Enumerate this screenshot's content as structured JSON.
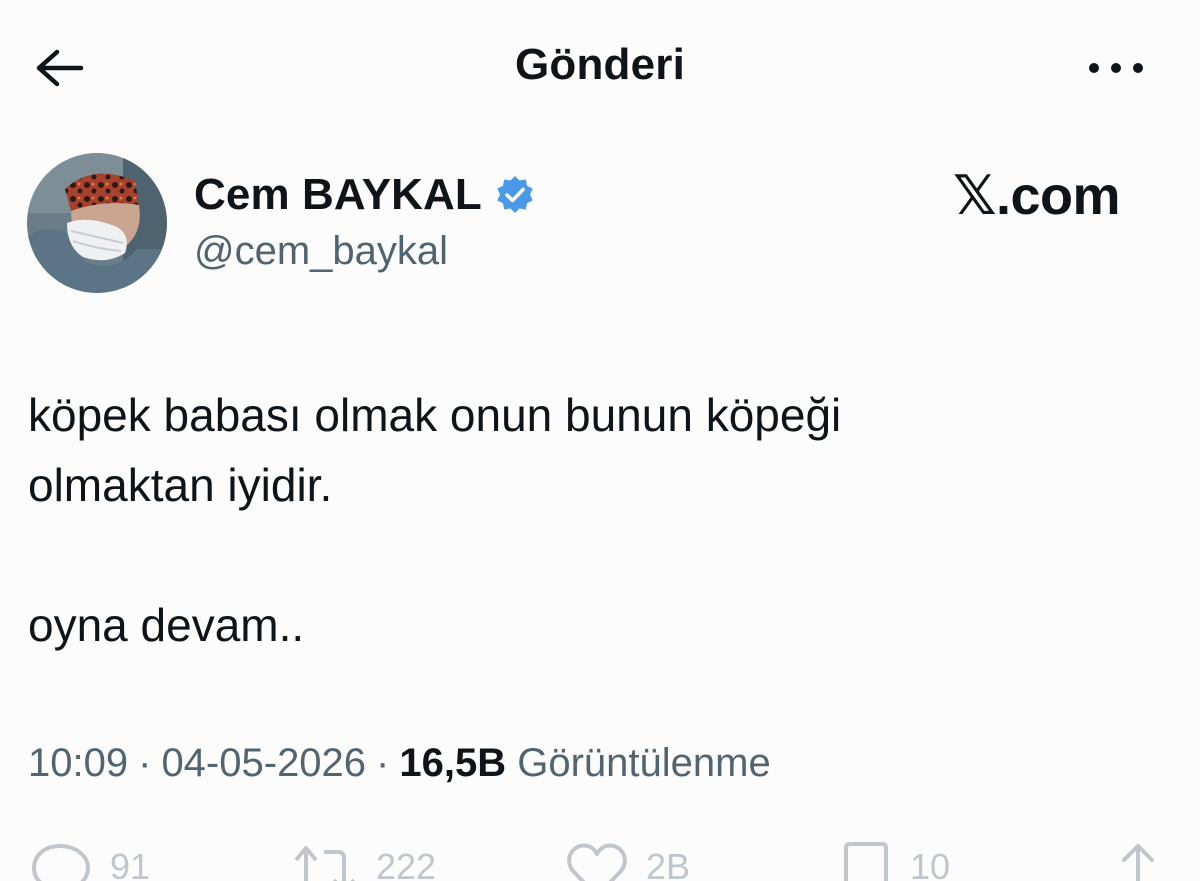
{
  "header": {
    "title": "Gönderi",
    "back_icon": "arrow-left-icon",
    "more_icon": "more-horizontal-icon"
  },
  "author": {
    "name": "Cem BAYKAL",
    "handle": "@cem_baykal",
    "verified": true,
    "verified_color": "#4a99e9"
  },
  "brand": {
    "text": "𝕏.com"
  },
  "tweet": {
    "lines": [
      "köpek babası olmak onun bunun köpeği",
      "olmaktan iyidir.",
      "",
      "oyna devam.."
    ]
  },
  "meta": {
    "time": "10:09",
    "date": "04-05-2026",
    "separator": "·",
    "views_count": "16,5B",
    "views_label": "Görüntülenme"
  },
  "actions": {
    "reply_count": "91",
    "retweet_count": "222",
    "like_count": "2B",
    "bookmark_count": "10"
  },
  "colors": {
    "text_primary": "#0f1419",
    "text_secondary": "#536471",
    "background": "#fcfcfc"
  }
}
